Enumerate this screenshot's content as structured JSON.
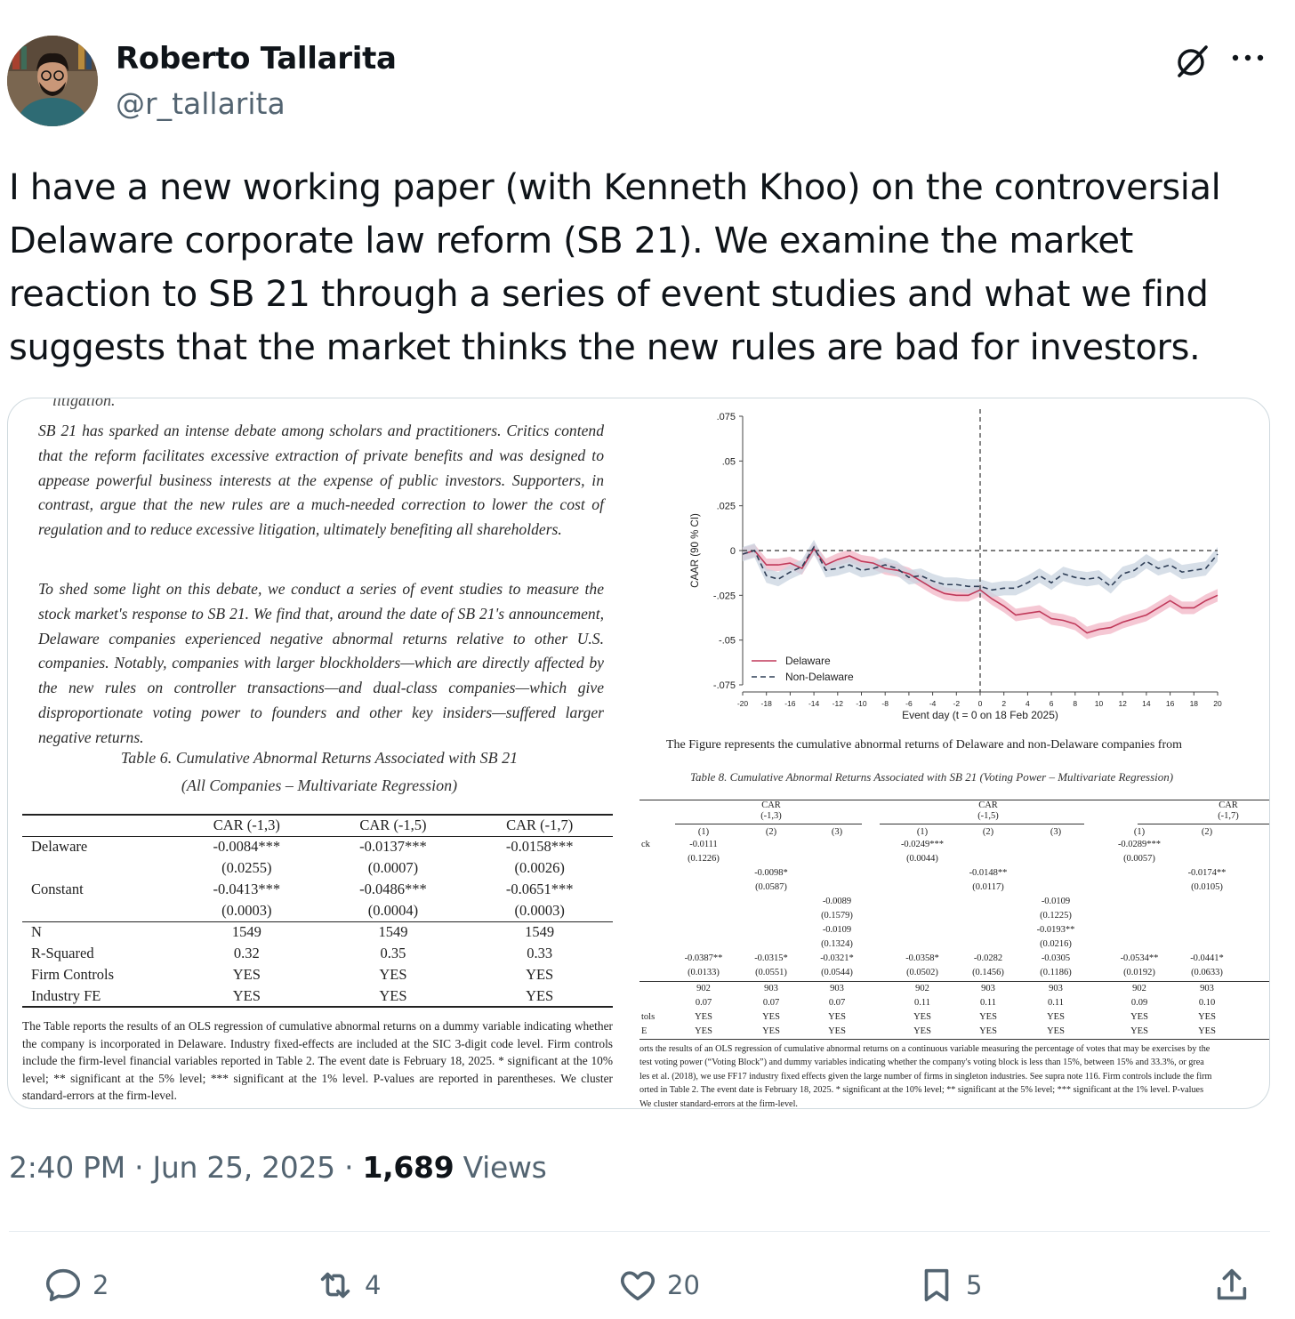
{
  "author": {
    "name": "Roberto Tallarita",
    "handle": "@r_tallarita"
  },
  "tweet": {
    "text": "I have a new working paper (with Kenneth Khoo) on the controversial Delaware corporate law reform (SB 21). We examine the market reaction to SB 21 through a series of event studies and what we find suggests that the market thinks the new rules are bad for investors."
  },
  "media": {
    "left": {
      "cut_top": "litigation.",
      "para1": "SB 21 has sparked an intense debate among scholars and practitioners. Critics contend that the reform facilitates excessive extraction of private benefits and was designed to appease powerful business interests at the expense of public investors. Supporters, in contrast, argue that the new rules are a much-needed correction to lower the cost of regulation and to reduce excessive litigation, ultimately benefiting all shareholders.",
      "para2": "To shed some light on this debate, we conduct a series of event studies to measure the stock market's response to SB 21. We find that, around the date of SB 21's announcement, Delaware companies experienced negative abnormal returns relative to other U.S. companies. Notably, companies with larger blockholders—which are directly affected by the new rules on controller transactions—and dual-class companies—which give disproportionate voting power to founders and other key insiders—suffered larger negative returns.",
      "table_title_1": "Table 6. Cumulative Abnormal Returns Associated with SB 21",
      "table_title_2": "(All Companies – Multivariate Regression)",
      "table": {
        "headers": [
          "",
          "CAR (-1,3)",
          "CAR (-1,5)",
          "CAR (-1,7)"
        ],
        "rows": [
          [
            "Delaware",
            "-0.0084***",
            "-0.0137***",
            "-0.0158***"
          ],
          [
            "",
            "(0.0255)",
            "(0.0007)",
            "(0.0026)"
          ],
          [
            "Constant",
            "-0.0413***",
            "-0.0486***",
            "-0.0651***"
          ],
          [
            "",
            "(0.0003)",
            "(0.0004)",
            "(0.0003)"
          ],
          [
            "N",
            "1549",
            "1549",
            "1549"
          ],
          [
            "R-Squared",
            "0.32",
            "0.35",
            "0.33"
          ],
          [
            "Firm Controls",
            "YES",
            "YES",
            "YES"
          ],
          [
            "Industry FE",
            "YES",
            "YES",
            "YES"
          ]
        ]
      },
      "note": "The Table reports the results of an OLS regression of cumulative abnormal returns on a dummy variable indicating whether the company is incorporated in Delaware. Industry fixed-effects are included at the SIC 3-digit code level. Firm controls include the firm-level financial variables reported in Table 2. The event date is February 18, 2025. * significant at the 10% level; ** significant at the 5% level; *** significant at the 1% level. P-values are reported in parentheses. We cluster standard-errors at the firm-level."
    },
    "right": {
      "figure_caption": "The Figure represents the cumulative abnormal returns of Delaware and non-Delaware companies from",
      "table_title": "Table 8. Cumulative Abnormal Returns Associated with SB 21 (Voting Power – Multivariate Regression)",
      "table": {
        "group_headers": [
          "CAR",
          "(-1,3)",
          "CAR",
          "(-1,5)",
          "CAR",
          "(-1,7)"
        ],
        "col_headers": [
          "(1)",
          "(2)",
          "(3)",
          "(1)",
          "(2)",
          "(3)",
          "(1)",
          "(2)"
        ],
        "row_labels": [
          "ck",
          "",
          "",
          "",
          "",
          "",
          "",
          "",
          "",
          "",
          "",
          "",
          "",
          "",
          "",
          "tols",
          "E"
        ],
        "r_vb": [
          "-0.0111",
          "-0.0249***",
          "-0.0289***"
        ],
        "r_vb_p": [
          "(0.1226)",
          "(0.0044)",
          "(0.0057)"
        ],
        "r_lt15": [
          "-0.0098*",
          "-0.0148**",
          "-0.0174**"
        ],
        "r_lt15_p": [
          "(0.0587)",
          "(0.0117)",
          "(0.0105)"
        ],
        "r_c3a": [
          "-0.0089",
          "-0.0109"
        ],
        "r_c3a_p": [
          "(0.1579)",
          "(0.1225)"
        ],
        "r_c3b": [
          "-0.0109",
          "-0.0193**"
        ],
        "r_c3b_p": [
          "(0.1324)",
          "(0.0216)"
        ],
        "r_const": [
          "-0.0387**",
          "-0.0315*",
          "-0.0321*",
          "-0.0358*",
          "-0.0282",
          "-0.0305",
          "-0.0534**",
          "-0.0441*"
        ],
        "r_const_p": [
          "(0.0133)",
          "(0.0551)",
          "(0.0544)",
          "(0.0502)",
          "(0.1456)",
          "(0.1186)",
          "(0.0192)",
          "(0.0633)"
        ],
        "r_n": [
          "902",
          "903",
          "903",
          "902",
          "903",
          "903",
          "902",
          "903"
        ],
        "r_r2": [
          "0.07",
          "0.07",
          "0.07",
          "0.11",
          "0.11",
          "0.11",
          "0.09",
          "0.10"
        ],
        "r_fc": [
          "YES",
          "YES",
          "YES",
          "YES",
          "YES",
          "YES",
          "YES",
          "YES"
        ],
        "r_fe": [
          "YES",
          "YES",
          "YES",
          "YES",
          "YES",
          "YES",
          "YES",
          "YES"
        ]
      },
      "note_lines": [
        "orts the results of an OLS regression of cumulative abnormal returns on a continuous variable measuring the percentage of votes that may be exercises by the",
        "test voting power (“Voting Block”) and dummy variables indicating whether the company's voting block is less than 15%, between 15% and 33.3%, or grea",
        "les et al. (2018), we use FF17 industry fixed effects given the large number of firms in singleton industries. See supra note 116. Firm controls include the firm",
        "orted in Table 2. The event date is February 18, 2025. * significant at the 10% level; ** significant at the 5% level; *** significant at the 1% level. P-values",
        "We cluster standard-errors at the firm-level."
      ]
    }
  },
  "chart_data": {
    "type": "line",
    "xlabel": "Event day  (t = 0 on 18 Feb 2025)",
    "ylabel": "CAAR (90 % CI)",
    "xlim": [
      -20,
      20
    ],
    "ylim": [
      -0.075,
      0.075
    ],
    "xticks": [
      -20,
      -18,
      -16,
      -14,
      -12,
      -10,
      -8,
      -6,
      -4,
      -2,
      0,
      2,
      4,
      6,
      8,
      10,
      12,
      14,
      16,
      18,
      20
    ],
    "yticks": [
      ".075",
      ".05",
      ".025",
      "0",
      "-.025",
      "-.05",
      "-.075"
    ],
    "ytick_values": [
      0.075,
      0.05,
      0.025,
      0,
      -0.025,
      -0.05,
      -0.075
    ],
    "x": [
      -20,
      -19,
      -18,
      -17,
      -16,
      -15,
      -14,
      -13,
      -12,
      -11,
      -10,
      -9,
      -8,
      -7,
      -6,
      -5,
      -4,
      -3,
      -2,
      -1,
      0,
      1,
      2,
      3,
      4,
      5,
      6,
      7,
      8,
      9,
      10,
      11,
      12,
      13,
      14,
      15,
      16,
      17,
      18,
      19,
      20
    ],
    "series": [
      {
        "name": "Delaware",
        "color": "#c0395a",
        "band": "#f2b6c6",
        "values": [
          -0.002,
          0.0,
          -0.008,
          -0.008,
          -0.007,
          -0.01,
          0.001,
          -0.008,
          -0.005,
          -0.003,
          -0.006,
          -0.007,
          -0.01,
          -0.011,
          -0.013,
          -0.017,
          -0.021,
          -0.024,
          -0.025,
          -0.025,
          -0.022,
          -0.027,
          -0.031,
          -0.036,
          -0.035,
          -0.034,
          -0.038,
          -0.039,
          -0.041,
          -0.046,
          -0.044,
          -0.043,
          -0.04,
          -0.038,
          -0.036,
          -0.032,
          -0.028,
          -0.032,
          -0.032,
          -0.028,
          -0.025
        ],
        "band_width": 0.0035
      },
      {
        "name": "Non-Delaware",
        "color": "#2f3f57",
        "band": "#c9d4e0",
        "values": [
          -0.002,
          0.0,
          -0.014,
          -0.016,
          -0.012,
          -0.009,
          0.002,
          -0.011,
          -0.01,
          -0.008,
          -0.011,
          -0.01,
          -0.008,
          -0.01,
          -0.015,
          -0.014,
          -0.017,
          -0.019,
          -0.019,
          -0.02,
          -0.02,
          -0.022,
          -0.021,
          -0.021,
          -0.018,
          -0.014,
          -0.018,
          -0.013,
          -0.015,
          -0.016,
          -0.015,
          -0.02,
          -0.013,
          -0.011,
          -0.006,
          -0.01,
          -0.008,
          -0.012,
          -0.011,
          -0.01,
          -0.002
        ],
        "band_width": 0.004
      }
    ],
    "vline_x": 0,
    "hline_y": 0,
    "legend_position": "bottom-left",
    "grid": false
  },
  "footer": {
    "time": "2:40 PM",
    "date": "Jun 25, 2025",
    "views_count": "1,689",
    "views_label": "Views",
    "replies": "2",
    "reposts": "4",
    "likes": "20",
    "bookmarks": "5"
  }
}
